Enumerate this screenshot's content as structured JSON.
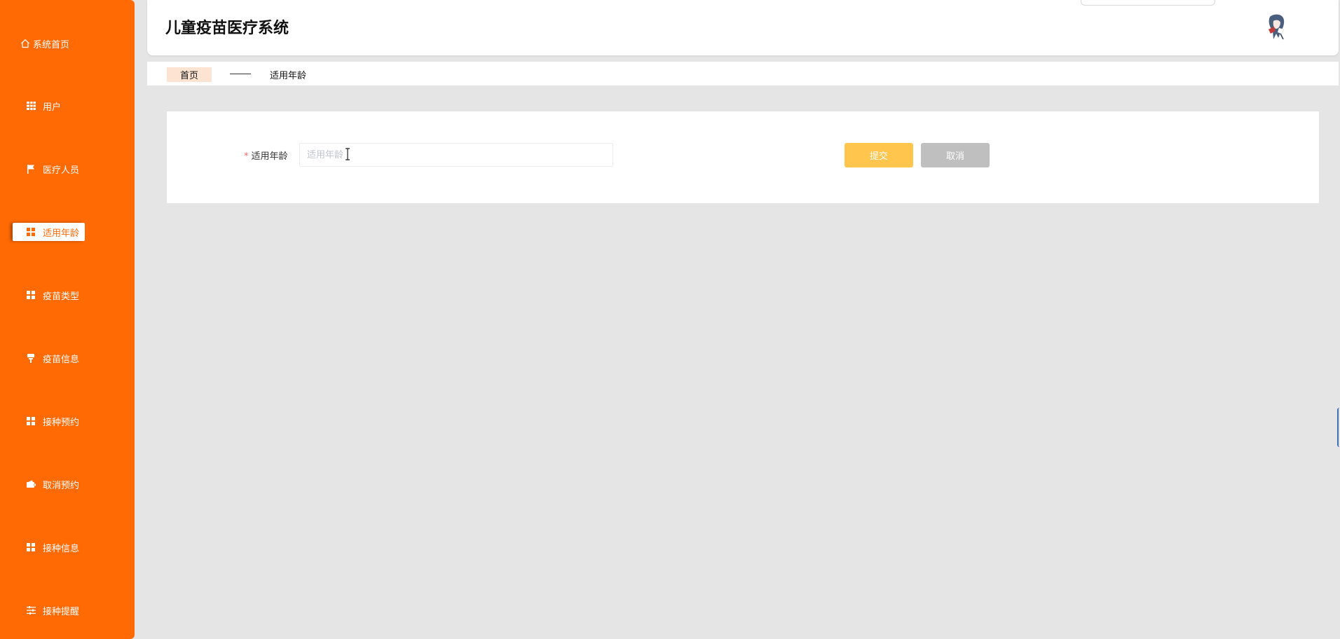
{
  "app": {
    "title": "儿童疫苗医疗系统"
  },
  "sidebar": {
    "items": [
      {
        "label": "系统首页",
        "icon": "home-icon"
      },
      {
        "label": "用户",
        "icon": "grid-icon"
      },
      {
        "label": "医疗人员",
        "icon": "flag-icon"
      },
      {
        "label": "适用年龄",
        "icon": "grid-icon",
        "active": true
      },
      {
        "label": "疫苗类型",
        "icon": "grid-icon"
      },
      {
        "label": "疫苗信息",
        "icon": "brush-icon"
      },
      {
        "label": "接种预约",
        "icon": "grid-icon"
      },
      {
        "label": "取消预约",
        "icon": "wallet-icon"
      },
      {
        "label": "接种信息",
        "icon": "grid-icon"
      },
      {
        "label": "接种提醒",
        "icon": "sliders-icon"
      }
    ]
  },
  "breadcrumb": {
    "home": "首页",
    "current": "适用年龄"
  },
  "form": {
    "field_label": "适用年龄",
    "required_mark": "*",
    "input_value": "",
    "input_placeholder": "适用年龄",
    "submit_label": "提交",
    "cancel_label": "取消"
  },
  "colors": {
    "sidebar": "#ff6a05",
    "submit": "#ffc54c",
    "cancel": "#c0bfbf",
    "background": "#e6e5e5",
    "breadcrumb_home_bg": "#fde3d1"
  }
}
